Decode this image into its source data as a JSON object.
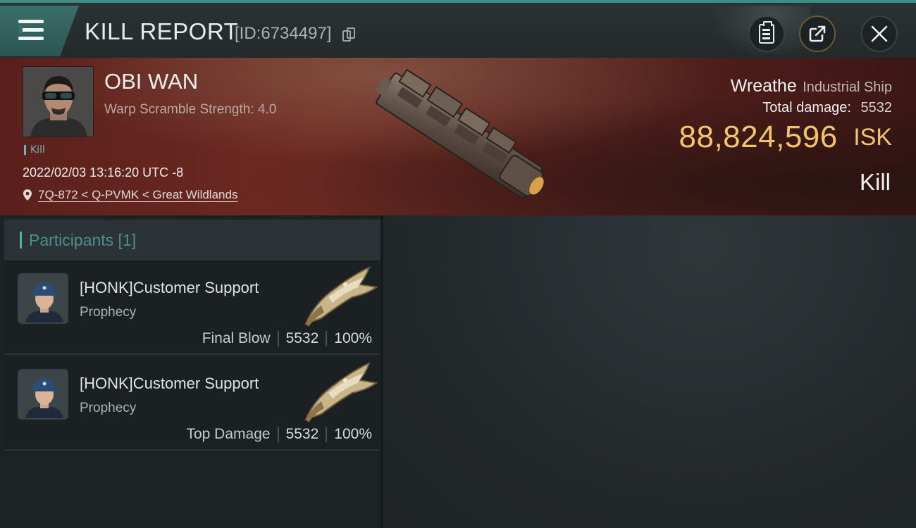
{
  "header": {
    "title": "KILL REPORT",
    "report_id": "[ID:6734497]"
  },
  "victim": {
    "name": "OBI WAN",
    "scramble": "Warp Scramble Strength: 4.0",
    "tag": "Kill",
    "timestamp": "2022/02/03 13:16:20 UTC -8",
    "location": "7Q-872 < Q-PVMK < Great Wildlands"
  },
  "ship": {
    "name": "Wreathe",
    "class": "Industrial Ship",
    "damage_label": "Total damage:",
    "damage_value": "5532",
    "isk_value": "88,824,596",
    "isk_unit": "ISK",
    "result": "Kill"
  },
  "participants": {
    "title": "Participants [1]",
    "rows": [
      {
        "name": "[HONK]Customer Support",
        "ship": "Prophecy",
        "blow": "Final Blow",
        "damage": "5532",
        "percent": "100%"
      },
      {
        "name": "[HONK]Customer Support",
        "ship": "Prophecy",
        "blow": "Top Damage",
        "damage": "5532",
        "percent": "100%"
      }
    ]
  },
  "colors": {
    "accent_teal": "#4fb0a5",
    "isk_gold": "#f4c46a",
    "banner_red": "#6e2a22"
  },
  "icons": [
    "menu-icon",
    "copy-icon",
    "clipboard-icon",
    "share-icon",
    "close-icon",
    "location-pin-icon"
  ]
}
